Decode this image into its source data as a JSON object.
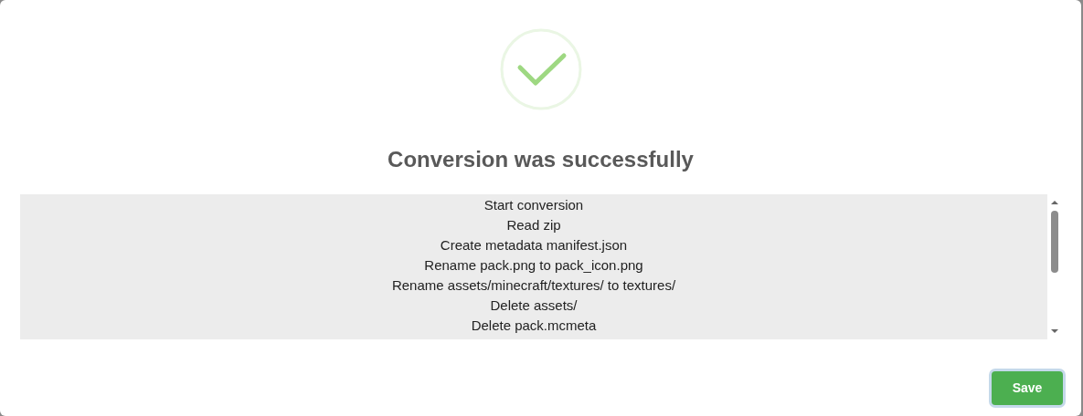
{
  "title": "Conversion was successfully",
  "log": [
    "Start conversion",
    "Read zip",
    "Create metadata manifest.json",
    "Rename pack.png to pack_icon.png",
    "Rename assets/minecraft/textures/ to textures/",
    "Delete assets/",
    "Delete pack.mcmeta"
  ],
  "buttons": [
    {
      "label": "Save",
      "focused": true
    }
  ]
}
